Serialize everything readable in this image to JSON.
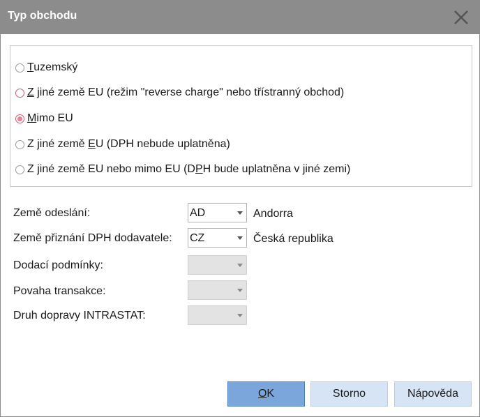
{
  "dialog": {
    "title": "Typ obchodu"
  },
  "trade_types": [
    {
      "underline": "T",
      "rest": "uzemský",
      "checked": false,
      "accent": false
    },
    {
      "underline": "Z",
      "rest": " jiné země EU (režim \"reverse charge\" nebo třístranný obchod)",
      "checked": false,
      "accent": true
    },
    {
      "underline": "M",
      "rest": "imo EU",
      "checked": true,
      "accent": true
    },
    {
      "pre": "Z jiné země ",
      "underline": "E",
      "rest": "U (DPH nebude uplatněna)",
      "checked": false,
      "accent": false
    },
    {
      "pre": "Z jiné země EU nebo mimo EU (D",
      "underline": "P",
      "rest": "H bude uplatněna v jiné zemi)",
      "checked": false,
      "accent": false
    }
  ],
  "form": {
    "dispatch_country": {
      "label": "Země odeslání:",
      "value": "AD",
      "description": "Andorra"
    },
    "supplier_vat_country": {
      "label": "Země přiznání DPH dodavatele:",
      "value": "CZ",
      "description": "Česká republika"
    },
    "delivery_terms": {
      "label": "Dodací podmínky:",
      "value": ""
    },
    "transaction_nature": {
      "label": "Povaha transakce:",
      "value": ""
    },
    "transport_mode": {
      "label": "Druh dopravy INTRASTAT:",
      "value": ""
    }
  },
  "buttons": {
    "ok": "OK",
    "ok_underline": "O",
    "ok_rest": "K",
    "cancel": "Storno",
    "help": "Nápověda"
  },
  "icons": {
    "close": "close-icon",
    "dropdown": "chevron-down-icon"
  },
  "colors": {
    "titlebar": "#8c8c8c",
    "radio_accent": "#e87f94",
    "primary_button": "#7aa6dc",
    "button": "#d6e4f5"
  }
}
